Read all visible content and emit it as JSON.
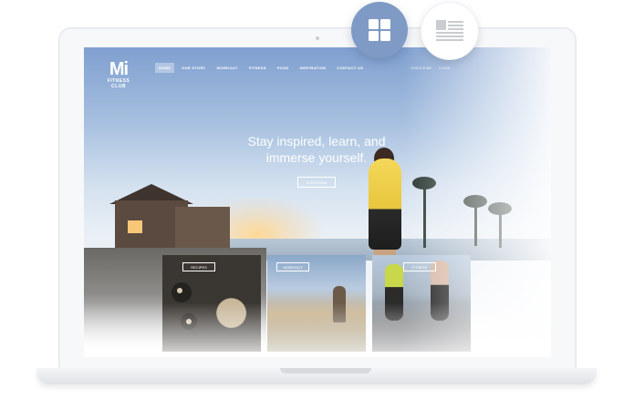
{
  "site": {
    "logo_mark": "Mi",
    "logo_line1": "FITNESS",
    "logo_line2": "CLUB"
  },
  "nav": {
    "items": [
      {
        "label": "HOME",
        "active": true
      },
      {
        "label": "OUR STORY",
        "active": false
      },
      {
        "label": "WORKOUT",
        "active": false
      },
      {
        "label": "FITNESS",
        "active": false
      },
      {
        "label": "FOOD",
        "active": false
      },
      {
        "label": "INSPIRATION",
        "active": false
      },
      {
        "label": "CONTACT US",
        "active": false
      }
    ],
    "right": [
      "SUBSCRIBE",
      "LOGIN"
    ]
  },
  "hero": {
    "line1": "Stay inspired, learn, and",
    "line2": "immerse yourself.",
    "button_label": "SUBSCRIBE"
  },
  "cards": [
    {
      "tag": "RECIPES"
    },
    {
      "tag": "WORKOUT"
    },
    {
      "tag": "FITNESS"
    }
  ],
  "view_switch": {
    "grid_icon": "grid-view-icon",
    "list_icon": "list-view-icon",
    "active": "grid",
    "accent": "#7f9ac4"
  }
}
